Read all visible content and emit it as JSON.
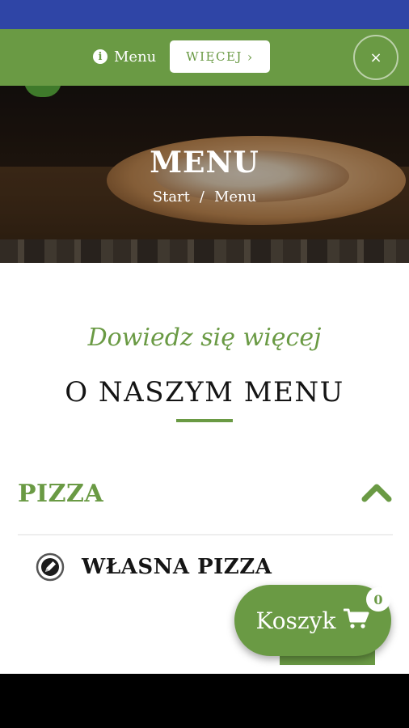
{
  "topbar": {
    "menu_label": "Menu",
    "more_button": "WIĘCEJ",
    "close_symbol": "×"
  },
  "hero": {
    "title": "MENU",
    "breadcrumb": [
      "Start",
      "/",
      "Menu"
    ]
  },
  "section": {
    "subtitle": "Dowiedz się więcej",
    "title": "O NASZYM MENU"
  },
  "category": {
    "title": "PIZZA",
    "items": [
      {
        "name": "WŁASNA PIZZA",
        "icon": "pencil-icon"
      }
    ]
  },
  "cart": {
    "label": "Koszyk",
    "count": "0",
    "icon": "cart-icon"
  },
  "colors": {
    "brand_green": "#6a9a44",
    "status_bar": "#2f45a6"
  }
}
